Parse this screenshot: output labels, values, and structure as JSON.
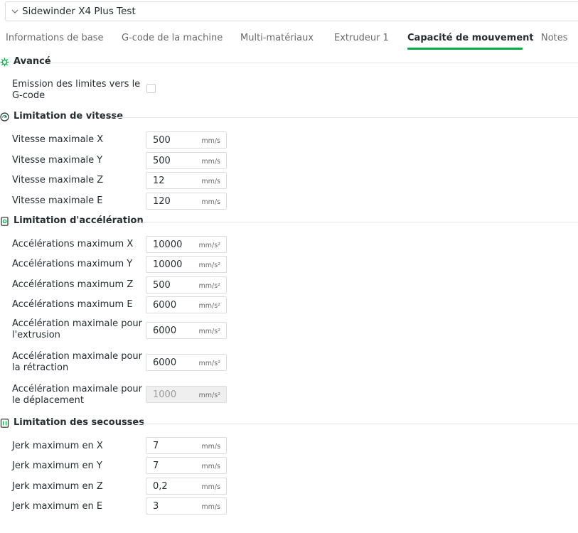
{
  "preset": {
    "name": "Sidewinder X4 Plus Test"
  },
  "tabs": [
    {
      "label": "Informations de base"
    },
    {
      "label": "G-code de la machine"
    },
    {
      "label": "Multi-matériaux"
    },
    {
      "label": "Extrudeur 1"
    },
    {
      "label": "Capacité de mouvement",
      "active": true
    },
    {
      "label": "Notes"
    }
  ],
  "colors": {
    "accent": "#00ae42",
    "text": "#262e30",
    "muted": "#6b6b6b",
    "border": "#dbdbdb"
  },
  "sections": {
    "advanced": {
      "title": "Avancé",
      "icon": "advanced-settings-icon",
      "emit_limits": {
        "label": "Emission des limites vers le G-code",
        "checked": false
      }
    },
    "speed": {
      "title": "Limitation de vitesse",
      "icon": "speed-gauge-icon",
      "rows": [
        {
          "label": "Vitesse maximale X",
          "value": "500",
          "unit": "mm/s"
        },
        {
          "label": "Vitesse maximale Y",
          "value": "500",
          "unit": "mm/s"
        },
        {
          "label": "Vitesse maximale Z",
          "value": "12",
          "unit": "mm/s"
        },
        {
          "label": "Vitesse maximale E",
          "value": "120",
          "unit": "mm/s"
        }
      ]
    },
    "accel": {
      "title": "Limitation d'accélération",
      "icon": "acceleration-icon",
      "rows": [
        {
          "label": "Accélérations maximum X",
          "value": "10000",
          "unit": "mm/s²"
        },
        {
          "label": "Accélérations maximum Y",
          "value": "10000",
          "unit": "mm/s²"
        },
        {
          "label": "Accélérations maximum Z",
          "value": "500",
          "unit": "mm/s²"
        },
        {
          "label": "Accélérations maximum E",
          "value": "6000",
          "unit": "mm/s²"
        },
        {
          "label": "Accélération maximale pour l'extrusion",
          "value": "6000",
          "unit": "mm/s²"
        },
        {
          "label": "Accélération maximale pour la rétraction",
          "value": "6000",
          "unit": "mm/s²"
        },
        {
          "label": "Accélération maximale pour le déplacement",
          "value": "1000",
          "unit": "mm/s²",
          "disabled": true
        }
      ]
    },
    "jerk": {
      "title": "Limitation des secousses",
      "icon": "jerk-limit-icon",
      "rows": [
        {
          "label": "Jerk maximum en X",
          "value": "7",
          "unit": "mm/s"
        },
        {
          "label": "Jerk maximum en Y",
          "value": "7",
          "unit": "mm/s"
        },
        {
          "label": "Jerk maximum en Z",
          "value": "0,2",
          "unit": "mm/s"
        },
        {
          "label": "Jerk maximum en E",
          "value": "3",
          "unit": "mm/s"
        }
      ]
    }
  }
}
